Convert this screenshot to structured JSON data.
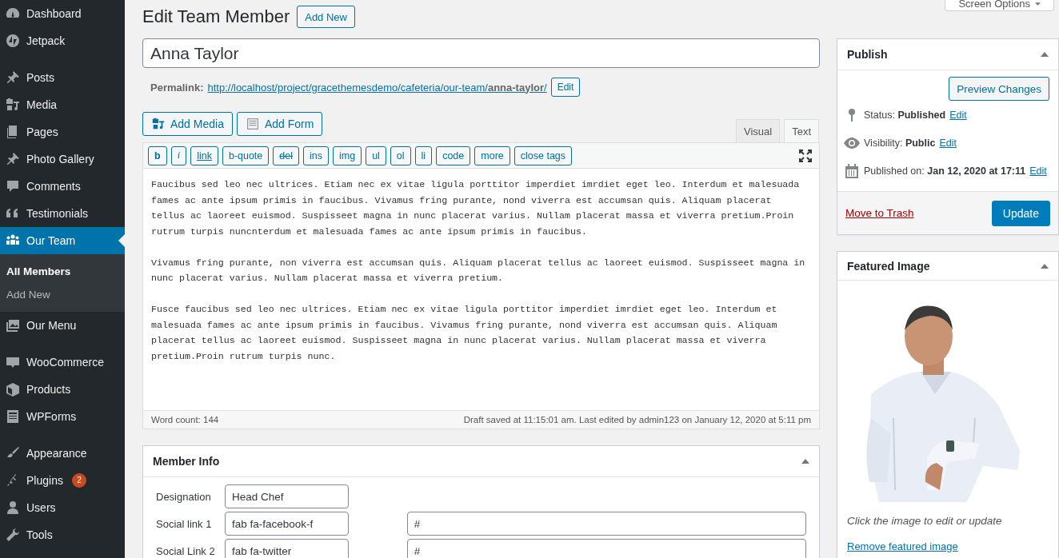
{
  "sidebar": {
    "groups": [
      {
        "items": [
          {
            "label": "Dashboard",
            "selected": false
          },
          {
            "label": "Jetpack",
            "selected": false
          }
        ]
      },
      {
        "items": [
          {
            "label": "Posts",
            "selected": false
          },
          {
            "label": "Media",
            "selected": false
          },
          {
            "label": "Pages",
            "selected": false
          },
          {
            "label": "Photo Gallery",
            "selected": false
          },
          {
            "label": "Comments",
            "selected": false
          },
          {
            "label": "Testimonials",
            "selected": false
          },
          {
            "label": "Our Team",
            "selected": true,
            "children": [
              {
                "label": "All Members",
                "selected": true
              },
              {
                "label": "Add New",
                "selected": false
              }
            ]
          },
          {
            "label": "Our Menu",
            "selected": false
          }
        ]
      },
      {
        "items": [
          {
            "label": "WooCommerce",
            "selected": false
          },
          {
            "label": "Products",
            "selected": false
          },
          {
            "label": "WPForms",
            "selected": false
          }
        ]
      },
      {
        "items": [
          {
            "label": "Appearance",
            "selected": false
          },
          {
            "label": "Plugins",
            "selected": false,
            "badge": "2"
          },
          {
            "label": "Users",
            "selected": false
          },
          {
            "label": "Tools",
            "selected": false
          }
        ]
      }
    ]
  },
  "header": {
    "title": "Edit Team Member",
    "add_new": "Add New"
  },
  "screen_options": "Screen Options",
  "post_title": {
    "value": "Anna Taylor"
  },
  "permalink": {
    "label": "Permalink:",
    "url": "http://localhost/project/gracethemesdemo/cafeteria/our-team/**anna-taylor**/",
    "edit": "Edit"
  },
  "editor": {
    "media_buttons": [
      "Add Media",
      "Add Form"
    ],
    "tabs": [
      {
        "label": "Visual",
        "selected": false
      },
      {
        "label": "Text",
        "selected": true
      }
    ],
    "quicktags": [
      {
        "label": "b",
        "kind": "bold"
      },
      {
        "label": "i",
        "kind": "italic"
      },
      {
        "label": "link",
        "kind": "underline"
      },
      {
        "label": "b-quote",
        "kind": "plain"
      },
      {
        "label": "del",
        "kind": "strike"
      },
      {
        "label": "ins",
        "kind": "plain"
      },
      {
        "label": "img",
        "kind": "plain"
      },
      {
        "label": "ul",
        "kind": "plain"
      },
      {
        "label": "ol",
        "kind": "plain"
      },
      {
        "label": "li",
        "kind": "plain"
      },
      {
        "label": "code",
        "kind": "plain"
      },
      {
        "label": "more",
        "kind": "plain"
      },
      {
        "label": "close tags",
        "kind": "plain"
      }
    ],
    "paragraphs": [
      "Faucibus sed leo nec ultrices. Etiam nec ex vitae ligula porttitor imperdiet imrdiet eget leo. Interdum et malesuada fames ac ante ipsum primis in faucibus. Vivamus fring purante, nond viverra est accumsan quis. Aliquam placerat tellus ac laoreet euismod. Suspisseet magna in nunc placerat varius. Nullam placerat massa et viverra pretium.Proin rutrum turpis nuncnterdum et malesuada fames ac ante ipsum primis in faucibus.",
      "Vivamus fring purante, non viverra est accumsan quis. Aliquam placerat tellus ac laoreet euismod. Suspisseet magna in nunc placerat varius. Nullam placerat massa et viverra pretium.",
      "Fusce faucibus sed leo nec ultrices. Etiam nec ex vitae ligula porttitor imperdiet imrdiet eget leo. Interdum et malesuada fames ac ante ipsum primis in faucibus. Vivamus fring purante, nond viverra est accumsan quis. Aliquam placerat tellus ac laoreet euismod. Suspisseet magna in nunc placerat varius. Nullam placerat massa et viverra pretium.Proin rutrum turpis nunc."
    ],
    "word_count": "Word count: 144",
    "last_edited": "Draft saved at 11:15:01 am. Last edited by admin123 on January 12, 2020 at 5:11 pm"
  },
  "member_info": {
    "title": "Member Info",
    "rows": [
      {
        "label": "Designation",
        "value": "Head Chef"
      },
      {
        "label": "Social link 1",
        "value": "fab fa-facebook-f",
        "url": "#"
      },
      {
        "label": "Social Link 2",
        "value": "fab fa-twitter",
        "url": "#"
      }
    ]
  },
  "publish": {
    "title": "Publish",
    "preview": "Preview Changes",
    "rows": [
      {
        "text": "Status: **Published**",
        "link": "Edit"
      },
      {
        "text": "Visibility: **Public**",
        "link": "Edit"
      },
      {
        "text": "Published on: **Jan 12, 2020 at 17:11**",
        "link": "Edit"
      }
    ],
    "trash": "Move to Trash",
    "update": "Update"
  },
  "featured_image": {
    "title": "Featured Image",
    "hint": "Click the image to edit or update",
    "remove": "Remove featured image"
  }
}
